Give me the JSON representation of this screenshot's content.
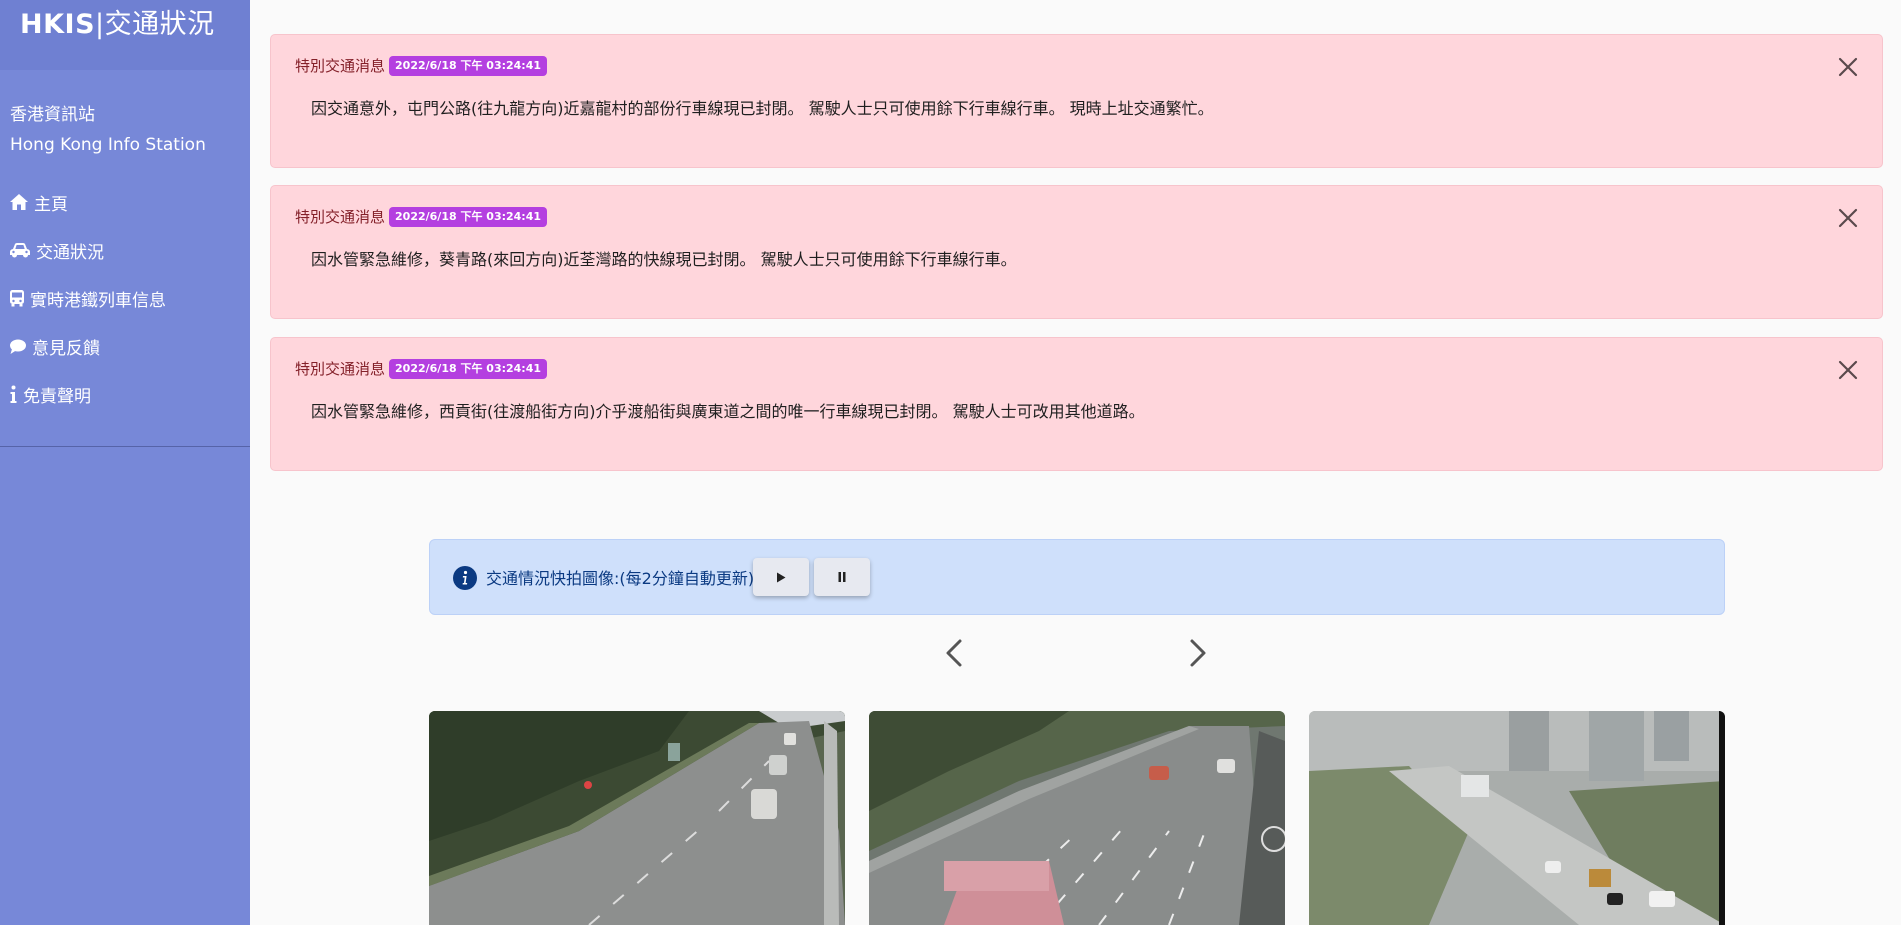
{
  "sidebar": {
    "brand_prefix": "HKIS",
    "brand_sep": "|",
    "brand_suffix": "交通狀況",
    "station_zh": "香港資訊站",
    "station_en": "Hong Kong Info Station",
    "nav": [
      {
        "label": "主頁",
        "icon": "home-icon"
      },
      {
        "label": "交通狀況",
        "icon": "car-icon"
      },
      {
        "label": "實時港鐵列車信息",
        "icon": "bus-icon"
      },
      {
        "label": "意見反饋",
        "icon": "comment-icon"
      },
      {
        "label": "免責聲明",
        "icon": "info-icon"
      }
    ]
  },
  "alerts": [
    {
      "label": "特別交通消息",
      "time": "2022/6/18 下午 03:24:41",
      "text": "因交通意外，屯門公路(往九龍方向)近嘉龍村的部份行車線現已封閉。 駕駛人士只可使用餘下行車線行車。 現時上址交通繁忙。"
    },
    {
      "label": "特別交通消息",
      "time": "2022/6/18 下午 03:24:41",
      "text": "因水管緊急維修，葵青路(來回方向)近荃灣路的快線現已封閉。 駕駛人士只可使用餘下行車線行車。"
    },
    {
      "label": "特別交通消息",
      "time": "2022/6/18 下午 03:24:41",
      "text": "因水管緊急維修，西貢街(往渡船街方向)介乎渡船街與廣東道之間的唯一行車線現已封閉。 駕駛人士可改用其他道路。"
    }
  ],
  "snapshot": {
    "text": "交通情況快拍圖像:(每2分鐘自動更新)",
    "play_icon": "play-icon",
    "pause_icon": "pause-icon"
  },
  "colors": {
    "sidebar": "#7788d8",
    "alert_bg": "#ffd6dc",
    "badge": "#b43fe0",
    "info_bg": "#cfe0fb"
  }
}
